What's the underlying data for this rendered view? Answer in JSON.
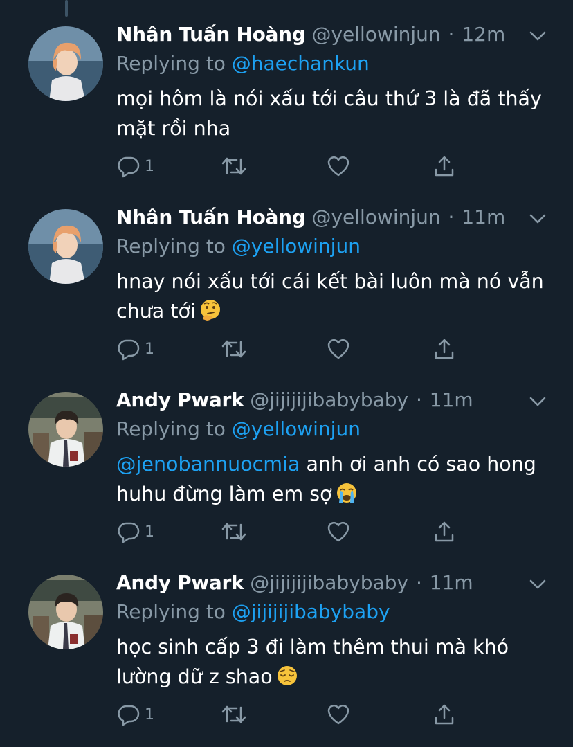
{
  "colors": {
    "background": "#15202b",
    "secondary_text": "#8899a6",
    "accent_link": "#1da1f2",
    "thread_line": "#3d5466"
  },
  "labels": {
    "replying_to": "Replying to",
    "dot": "·"
  },
  "tweets": [
    {
      "name": "Nhân Tuấn Hoàng",
      "handle": "@yellowinjun",
      "time": "12m",
      "replying_to": "@haechankun",
      "mention": "",
      "text": "mọi hôm là nói xấu tới câu thứ 3 là đã thấy mặt rồi nha",
      "emoji": "",
      "reply_count": "1",
      "avatar": "avatar-orange-hair"
    },
    {
      "name": "Nhân Tuấn Hoàng",
      "handle": "@yellowinjun",
      "time": "11m",
      "replying_to": "@yellowinjun",
      "mention": "",
      "text": "hnay nói xấu tới cái kết bài luôn mà nó vẫn chưa tới",
      "emoji": "thinking-face-emoji",
      "reply_count": "1",
      "avatar": "avatar-orange-hair"
    },
    {
      "name": "Andy Pwark",
      "handle": "@jijijijibabybaby",
      "time": "11m",
      "replying_to": "@yellowinjun",
      "mention": "@jenobannuocmia",
      "text": "anh ơi anh có sao hong huhu đừng làm em sợ",
      "emoji": "crying-face-emoji",
      "reply_count": "1",
      "avatar": "avatar-classroom"
    },
    {
      "name": "Andy Pwark",
      "handle": "@jijijijibabybaby",
      "time": "11m",
      "replying_to": "@jijijijibabybaby",
      "mention": "",
      "text": "học sinh cấp 3 đi làm thêm thui mà khó lường dữ z shao",
      "emoji": "pensive-face-emoji",
      "reply_count": "1",
      "avatar": "avatar-classroom"
    }
  ]
}
